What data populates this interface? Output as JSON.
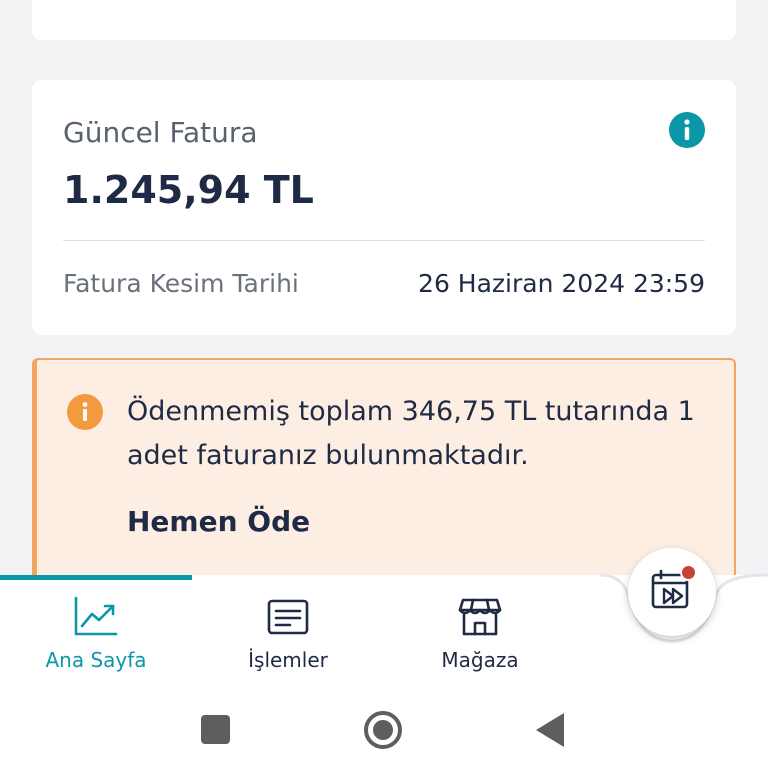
{
  "invoice": {
    "title": "Güncel Fatura",
    "amount": "1.245,94 TL",
    "cutoff_label": "Fatura Kesim Tarihi",
    "cutoff_value": "26 Haziran 2024 23:59",
    "info_icon": "info-icon",
    "accent_color": "#0b97a7"
  },
  "alert": {
    "message": "Ödenmemiş toplam 346,75 TL tutarında 1 adet faturanız bulunmaktadır.",
    "action_label": "Hemen Öde",
    "icon": "warning-info-icon",
    "background_color": "#fdeee3",
    "border_color": "#f3a45e"
  },
  "bottom_nav": {
    "items": [
      {
        "label": "Ana Sayfa",
        "icon": "chart-icon",
        "active": true
      },
      {
        "label": "İşlemler",
        "icon": "document-list-icon",
        "active": false
      },
      {
        "label": "Mağaza",
        "icon": "store-icon",
        "active": false
      }
    ],
    "fab_icon": "video-calendar-icon"
  },
  "system_nav": {
    "buttons": [
      "recents-icon",
      "home-icon",
      "back-icon"
    ]
  }
}
